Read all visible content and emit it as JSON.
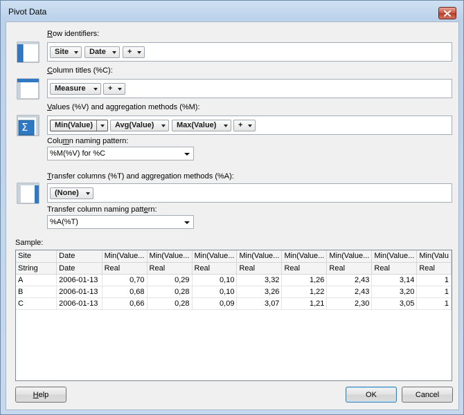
{
  "window": {
    "title": "Pivot Data"
  },
  "row_identifiers": {
    "label_accel": "R",
    "label_rest": "ow identifiers:",
    "chips": [
      "Site",
      "Date",
      "+"
    ]
  },
  "column_titles": {
    "label_accel": "C",
    "label_rest": "olumn titles (%C):",
    "chips": [
      "Measure",
      "+"
    ]
  },
  "values": {
    "label_accel": "V",
    "label_rest": "alues (%V) and aggregation methods (%M):",
    "chips": [
      "Min(Value)",
      "Avg(Value)",
      "Max(Value)",
      "+"
    ],
    "icon_symbol": "Σ"
  },
  "column_naming": {
    "label_pre": "Colu",
    "label_accel": "m",
    "label_rest": "n naming pattern:",
    "value": "%M(%V) for %C"
  },
  "transfer_columns": {
    "label_accel": "T",
    "label_rest": "ransfer columns (%T) and aggregation methods (%A):",
    "chips": [
      "(None)"
    ]
  },
  "transfer_naming": {
    "label_pre": "Transfer column naming patt",
    "label_accel": "e",
    "label_rest": "rn:",
    "value": "%A(%T)"
  },
  "sample": {
    "label": "Sample:",
    "headers": [
      "Site",
      "Date",
      "Min(Value...",
      "Min(Value...",
      "Min(Value...",
      "Min(Value...",
      "Min(Value...",
      "Min(Value...",
      "Min(Value...",
      "Min(Valu"
    ],
    "types": [
      "String",
      "Date",
      "Real",
      "Real",
      "Real",
      "Real",
      "Real",
      "Real",
      "Real",
      "Real"
    ],
    "rows": [
      [
        "A",
        "2006-01-13",
        "0,70",
        "0,29",
        "0,10",
        "3,32",
        "1,26",
        "2,43",
        "3,14",
        "1"
      ],
      [
        "B",
        "2006-01-13",
        "0,68",
        "0,28",
        "0,10",
        "3,26",
        "1,22",
        "2,43",
        "3,20",
        "1"
      ],
      [
        "C",
        "2006-01-13",
        "0,66",
        "0,28",
        "0,09",
        "3,07",
        "1,21",
        "2,30",
        "3,05",
        "1"
      ]
    ]
  },
  "buttons": {
    "help_accel": "H",
    "help_rest": "elp",
    "ok": "OK",
    "cancel": "Cancel"
  },
  "colors": {
    "icon_blue": "#2f78c4",
    "title_gradient_top": "#cfe0f2",
    "close_red": "#c8533f"
  }
}
